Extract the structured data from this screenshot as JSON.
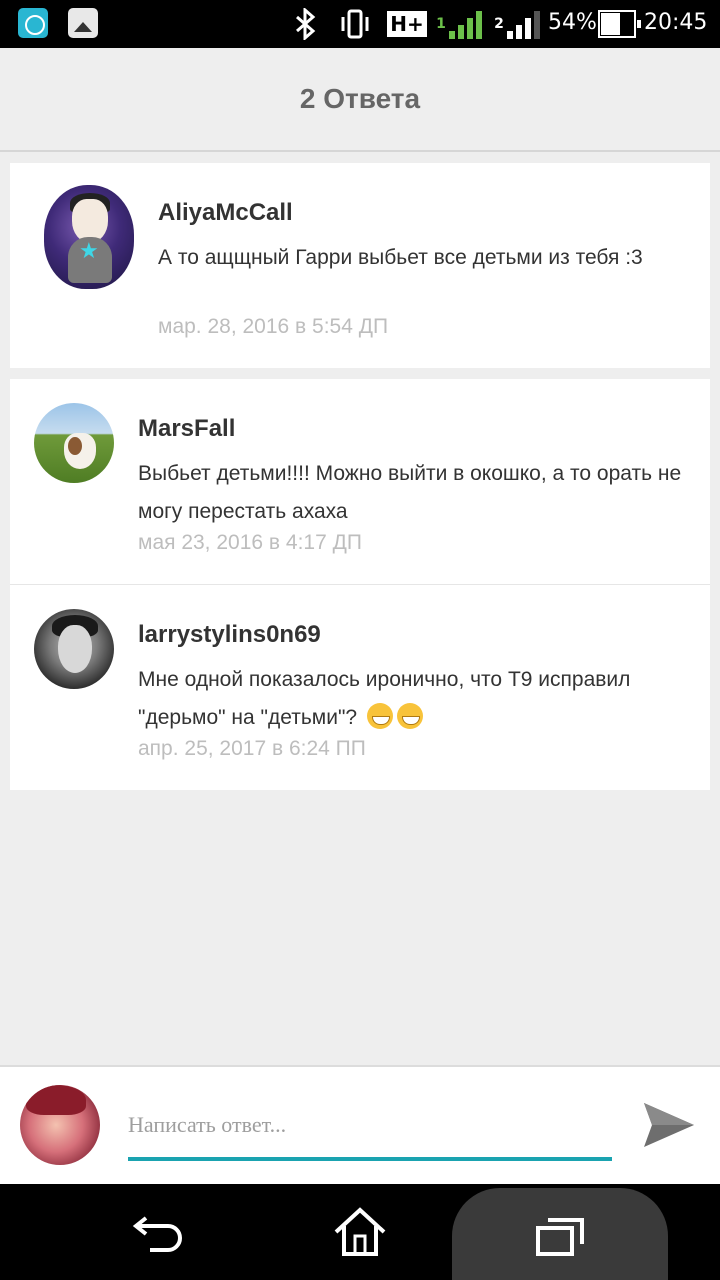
{
  "status_bar": {
    "battery_percent": "54%",
    "time": "20:45",
    "signal_sim1": "1",
    "signal_sim2": "2",
    "network_type": "H+",
    "icons": [
      "fitness-app-icon",
      "gallery-icon",
      "bluetooth-icon",
      "vibrate-icon",
      "h-plus-icon",
      "signal-sim1-icon",
      "signal-sim2-icon",
      "battery-icon"
    ]
  },
  "header": {
    "title": "2 Ответа"
  },
  "original_comment": {
    "username": "AliyaMcCall",
    "text": "А то ащщный Гарри выбьет все детьми из тебя :3",
    "date": "мар. 28, 2016 в 5:54 ДП"
  },
  "replies": [
    {
      "username": "MarsFall",
      "text": "Выбьет детьми!!!! Можно выйти в окошко, а то орать не могу перестать ахаха",
      "date": "мая 23, 2016 в 4:17 ДП"
    },
    {
      "username": "larrystylins0n69",
      "text": "Мне одной показалось иронично, что Т9 исправил \"дерьмо\" на \"детьми\"?",
      "emojis": [
        "grinning-face-emoji",
        "grinning-face-emoji"
      ],
      "date": "апр. 25, 2017 в 6:24 ПП"
    }
  ],
  "composer": {
    "placeholder": "Написать ответ...",
    "value": "",
    "accent_color": "#1aa3b0"
  },
  "nav_bar": {
    "icons": [
      "back-icon",
      "home-icon",
      "recent-apps-icon"
    ]
  }
}
